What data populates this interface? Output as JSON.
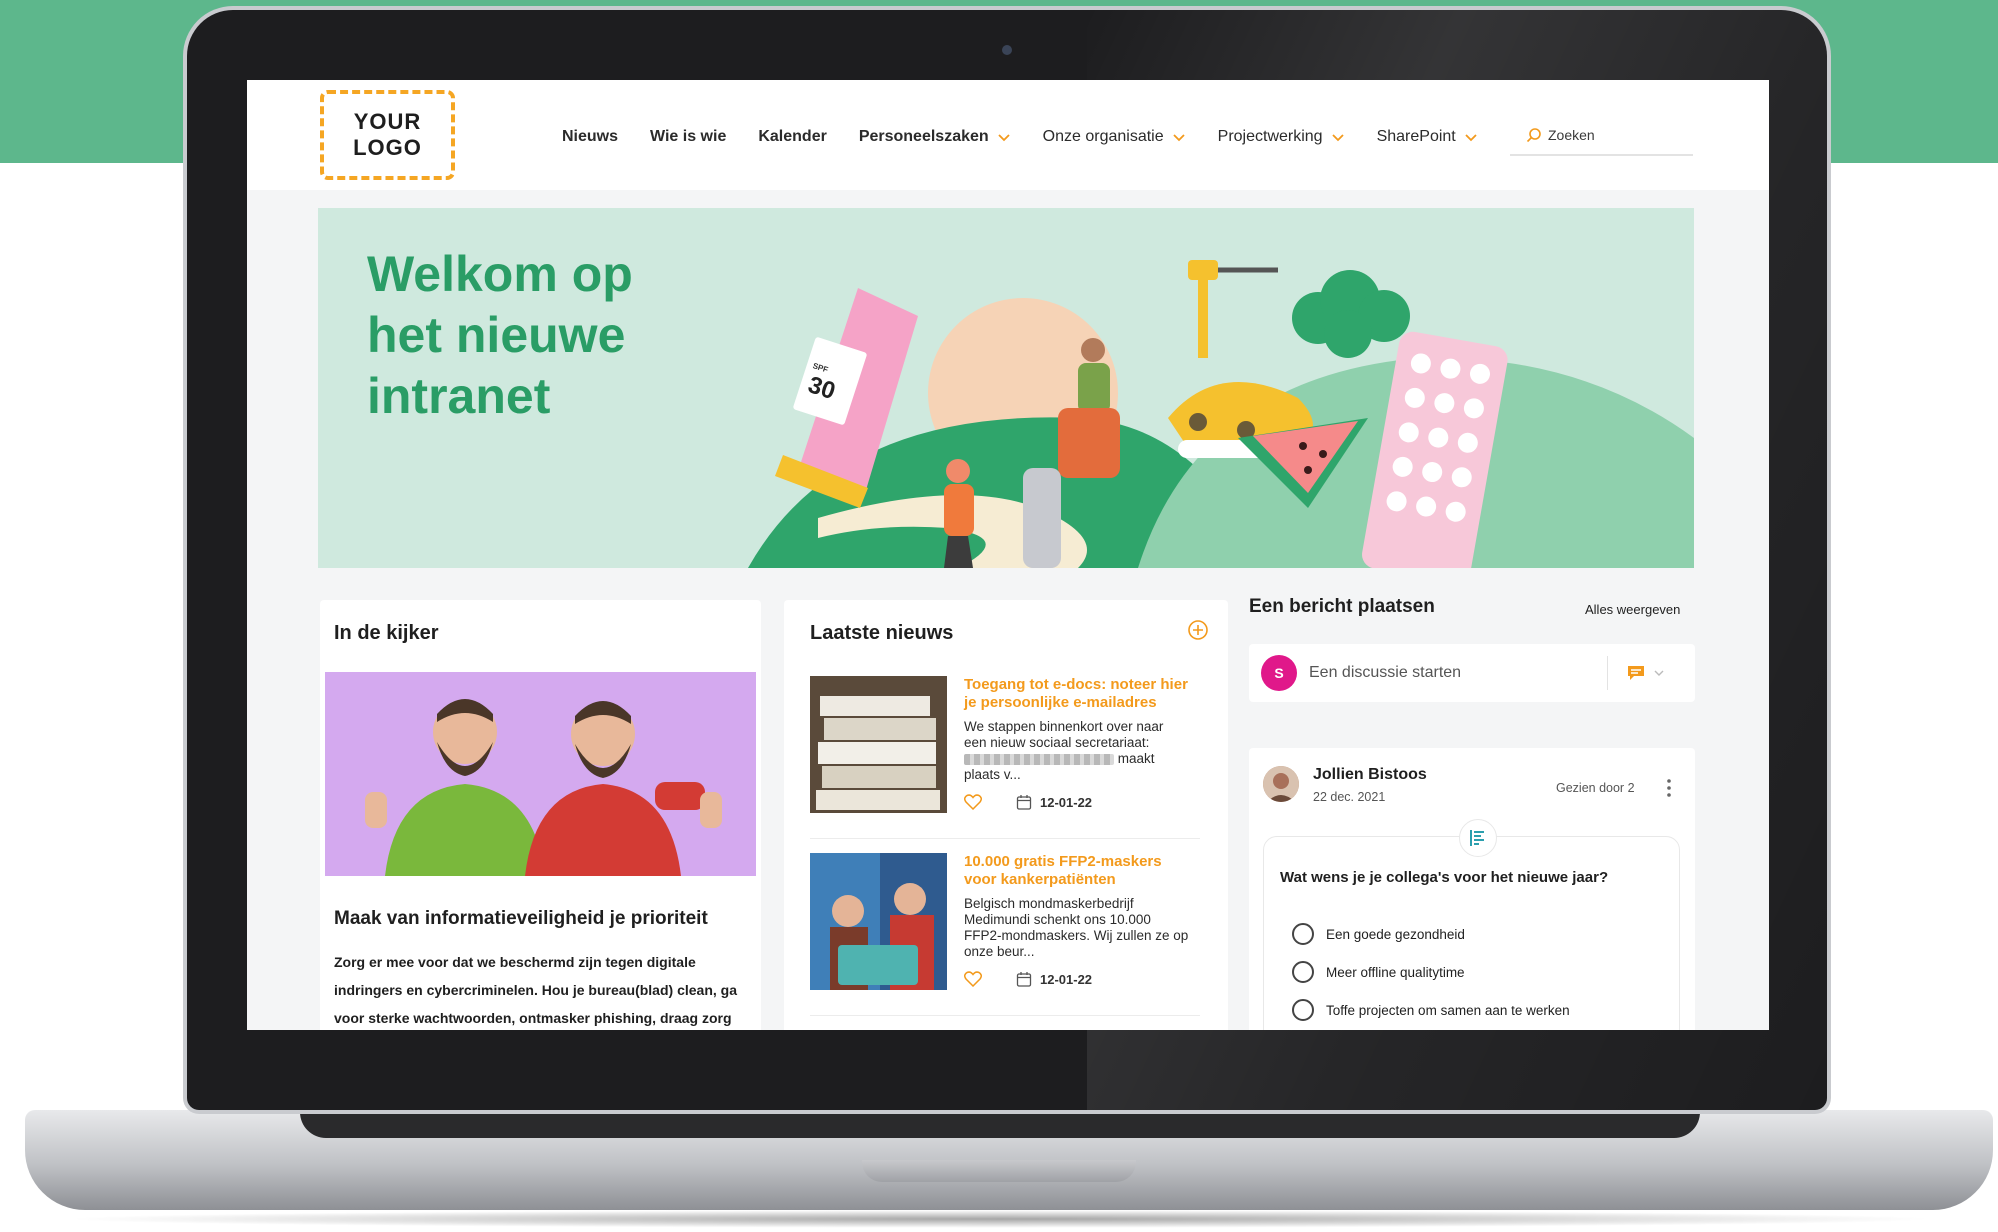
{
  "logo": {
    "line1": "YOUR",
    "line2": "LOGO"
  },
  "nav": {
    "items": [
      {
        "label": "Nieuws",
        "dropdown": false
      },
      {
        "label": "Wie is wie",
        "dropdown": false
      },
      {
        "label": "Kalender",
        "dropdown": false
      },
      {
        "label": "Personeelszaken",
        "dropdown": true
      },
      {
        "label": "Onze organisatie",
        "dropdown": true
      },
      {
        "label": "Projectwerking",
        "dropdown": true
      },
      {
        "label": "SharePoint",
        "dropdown": true
      }
    ],
    "search_placeholder": "Zoeken"
  },
  "hero": {
    "title": "Welkom op het nieuwe intranet",
    "spf_label": "SPF",
    "spf_value": "30"
  },
  "in_de_kijker": {
    "title": "In de kijker",
    "headline": "Maak van informatieveiligheid je prioriteit",
    "body": "Zorg er mee voor dat we beschermd zijn tegen digitale indringers en cybercriminelen. Hou je bureau(blad) clean, ga voor sterke wachtwoorden, ontmasker phishing, draag zorg"
  },
  "laatste_nieuws": {
    "title": "Laatste nieuws",
    "items": [
      {
        "headline": "Toegang tot e-docs: noteer hier je persoonlijke e-mailadres",
        "body_start": "We stappen binnenkort over naar een nieuw sociaal secretariaat:",
        "body_end": "maakt plaats v...",
        "date": "12-01-22"
      },
      {
        "headline": "10.000 gratis FFP2-maskers voor kankerpatiënten",
        "body": "Belgisch mondmaskerbedrijf Medimundi schenkt ons 10.000 FFP2-mondmaskers. Wij zullen ze op onze beur...",
        "date": "12-01-22"
      }
    ]
  },
  "post": {
    "title": "Een bericht plaatsen",
    "show_all": "Alles weergeven",
    "avatar_initial": "S",
    "input_placeholder": "Een discussie starten",
    "author": "Jollien Bistoos",
    "date": "22 dec. 2021",
    "seen": "Gezien door 2",
    "poll": {
      "question": "Wat wens je je collega's voor het nieuwe jaar?",
      "options": [
        "Een goede gezondheid",
        "Meer offline qualitytime",
        "Toffe projecten om samen aan te werken"
      ]
    }
  },
  "colors": {
    "accent_green": "#2a9d66",
    "accent_orange": "#f39a1c",
    "bg_green": "#5db78c",
    "avatar_pink": "#e0188a"
  }
}
